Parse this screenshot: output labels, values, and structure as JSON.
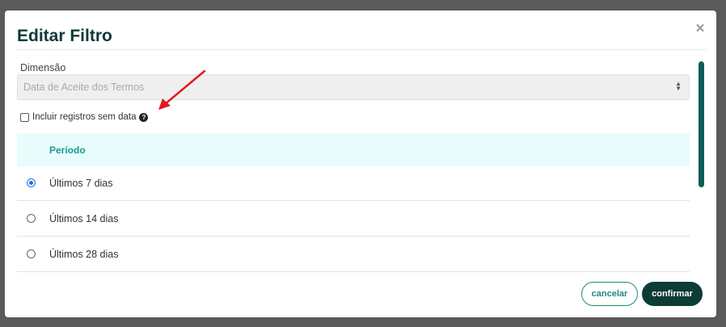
{
  "modal": {
    "title": "Editar Filtro",
    "close_symbol": "×"
  },
  "dimension": {
    "label": "Dimensão",
    "value": "Data de Aceite dos Termos",
    "caret_up": "▲",
    "caret_down": "▼"
  },
  "include_without_date": {
    "label": "Incluir registros sem data",
    "checked": false,
    "help_symbol": "?"
  },
  "period": {
    "header": "Período",
    "options": [
      {
        "label": "Últimos 7 dias",
        "selected": true
      },
      {
        "label": "Últimos 14 dias",
        "selected": false
      },
      {
        "label": "Últimos 28 dias",
        "selected": false
      }
    ]
  },
  "footer": {
    "cancel_label": "cancelar",
    "confirm_label": "confirmar"
  },
  "colors": {
    "brand_dark": "#0d3b36",
    "brand_teal": "#1a8a80",
    "radio_selected": "#1a6fe0",
    "annotation_arrow": "#e01a1a"
  },
  "icons": {
    "close": "close-icon",
    "caret": "select-caret-icon",
    "help": "question-circle-icon",
    "annotation": "red-arrow-annotation"
  }
}
